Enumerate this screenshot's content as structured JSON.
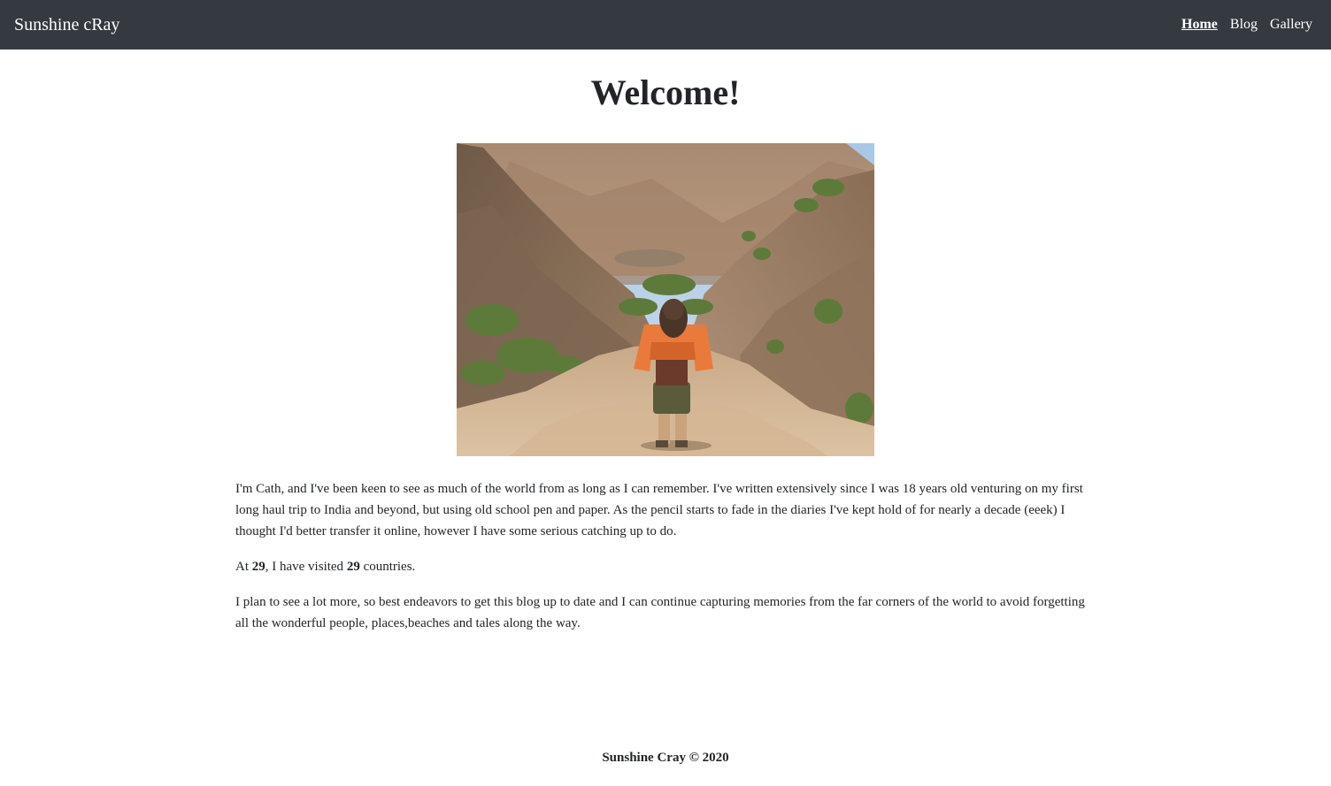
{
  "navbar": {
    "brand": "Sunshine cRay",
    "links": [
      {
        "label": "Home",
        "active": true
      },
      {
        "label": "Blog",
        "active": false
      },
      {
        "label": "Gallery",
        "active": false
      }
    ]
  },
  "main": {
    "title": "Welcome!",
    "hero_image_alt": "",
    "intro": "I'm Cath, and I've been keen to see as much of the world from as long as I can remember. I've written extensively since I was 18 years old venturing on my first long haul trip to India and beyond, but using old school pen and paper. As the pencil starts to fade in the diaries I've kept hold of for nearly a decade (eeek) I thought I'd better transfer it online, however I have some serious catching up to do.",
    "stats": {
      "prefix": "At ",
      "age": "29",
      "middle": ", I have visited ",
      "countries": "29",
      "suffix": " countries."
    },
    "closing": "I plan to see a lot more, so best endeavors to get this blog up to date and I can continue capturing memories from the far corners of the world to avoid forgetting all the wonderful people, places,beaches and tales along the way."
  },
  "footer": {
    "text": "Sunshine Cray © 2020"
  },
  "colors": {
    "navbar_bg": "#343a40",
    "text": "#212529"
  }
}
